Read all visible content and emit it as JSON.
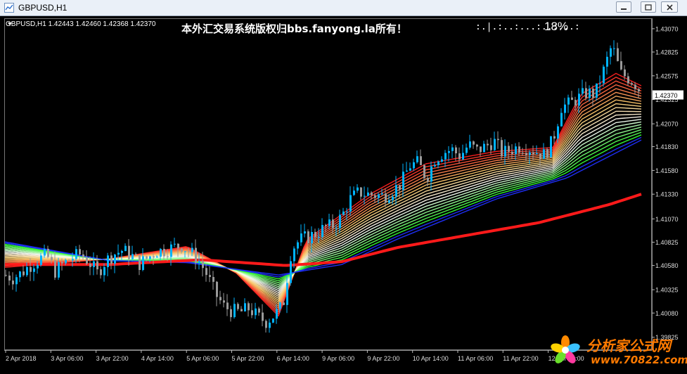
{
  "window": {
    "title": "GBPUSD,H1"
  },
  "chart_header": {
    "symbol_info": "GBPUSD,H1  1.42443 1.42460 1.42368 1.42370",
    "title": "本外汇交易系统版权归bbs.fanyong.la所有！",
    "progress_text": ":.|.:..:...:..:...:",
    "progress_percent": "18%"
  },
  "watermark": {
    "brand_cn": "分析家公式网",
    "url": "www.70822.com"
  },
  "colors": {
    "background": "#000000",
    "bull_candle": "#00b4ff",
    "bear_candle": "#9a9a9a",
    "slow_ma": "#ff1a1a",
    "ribbon_top": "#ff2020",
    "ribbon_mid": "#ffffff",
    "ribbon_low": "#22ff22",
    "ribbon_bottom": "#2030ff",
    "current_price_box": "#ffffff"
  },
  "chart_data": {
    "type": "candlestick",
    "symbol": "GBPUSD",
    "timeframe": "H1",
    "current_price": "1.42370",
    "ylim": [
      1.3969,
      1.4318
    ],
    "y_ticks": [
      "1.43070",
      "1.42825",
      "1.42575",
      "1.42325",
      "1.42070",
      "1.41830",
      "1.41580",
      "1.41330",
      "1.41070",
      "1.40825",
      "1.40580",
      "1.40325",
      "1.40080",
      "1.39825"
    ],
    "x_ticks": [
      "2 Apr 2018",
      "3 Apr 06:00",
      "3 Apr 22:00",
      "4 Apr 14:00",
      "5 Apr 06:00",
      "5 Apr 22:00",
      "6 Apr 14:00",
      "9 Apr 06:00",
      "9 Apr 22:00",
      "10 Apr 14:00",
      "11 Apr 06:00",
      "11 Apr 22:00",
      "12 Apr 14:00"
    ],
    "close_path": [
      [
        0,
        1.4048
      ],
      [
        12,
        1.4045
      ],
      [
        24,
        1.405
      ],
      [
        36,
        1.4058
      ],
      [
        48,
        1.4064
      ],
      [
        60,
        1.4069
      ],
      [
        72,
        1.4052
      ],
      [
        84,
        1.406
      ],
      [
        96,
        1.4066
      ],
      [
        108,
        1.407
      ],
      [
        120,
        1.4062
      ],
      [
        132,
        1.405
      ],
      [
        144,
        1.4063
      ],
      [
        156,
        1.407
      ],
      [
        168,
        1.4074
      ],
      [
        180,
        1.4069
      ],
      [
        192,
        1.406
      ],
      [
        204,
        1.4066
      ],
      [
        216,
        1.4073
      ],
      [
        228,
        1.4074
      ],
      [
        240,
        1.4077
      ],
      [
        252,
        1.4079
      ],
      [
        264,
        1.4072
      ],
      [
        276,
        1.4064
      ],
      [
        288,
        1.4048
      ],
      [
        300,
        1.4028
      ],
      [
        312,
        1.4015
      ],
      [
        324,
        1.401
      ],
      [
        336,
        1.4009
      ],
      [
        348,
        1.4013
      ],
      [
        360,
        1.4004
      ],
      [
        372,
        1.3999
      ],
      [
        384,
        1.4006
      ],
      [
        396,
        1.4016
      ],
      [
        408,
        1.4075
      ],
      [
        420,
        1.4085
      ],
      [
        432,
        1.4088
      ],
      [
        444,
        1.4092
      ],
      [
        456,
        1.4098
      ],
      [
        468,
        1.41
      ],
      [
        480,
        1.411
      ],
      [
        492,
        1.4128
      ],
      [
        504,
        1.4135
      ],
      [
        516,
        1.4133
      ],
      [
        528,
        1.4132
      ],
      [
        540,
        1.4131
      ],
      [
        552,
        1.4137
      ],
      [
        564,
        1.4144
      ],
      [
        576,
        1.4163
      ],
      [
        588,
        1.4166
      ],
      [
        600,
        1.415
      ],
      [
        612,
        1.417
      ],
      [
        624,
        1.4177
      ],
      [
        636,
        1.418
      ],
      [
        648,
        1.4173
      ],
      [
        660,
        1.4185
      ],
      [
        672,
        1.4179
      ],
      [
        684,
        1.4183
      ],
      [
        696,
        1.4189
      ],
      [
        708,
        1.4176
      ],
      [
        720,
        1.418
      ],
      [
        732,
        1.4183
      ],
      [
        744,
        1.4182
      ],
      [
        756,
        1.4178
      ],
      [
        768,
        1.4174
      ],
      [
        780,
        1.419
      ],
      [
        792,
        1.4225
      ],
      [
        804,
        1.4228
      ],
      [
        816,
        1.4234
      ],
      [
        828,
        1.424
      ],
      [
        840,
        1.4238
      ],
      [
        852,
        1.4263
      ],
      [
        864,
        1.429
      ],
      [
        876,
        1.426
      ],
      [
        888,
        1.4255
      ],
      [
        900,
        1.4247
      ],
      [
        906,
        1.4237
      ]
    ],
    "slow_ma": [
      [
        0,
        1.4059
      ],
      [
        150,
        1.4059
      ],
      [
        280,
        1.4064
      ],
      [
        400,
        1.4058
      ],
      [
        480,
        1.4062
      ],
      [
        560,
        1.4077
      ],
      [
        660,
        1.409
      ],
      [
        760,
        1.4103
      ],
      [
        860,
        1.4122
      ],
      [
        906,
        1.4133
      ]
    ],
    "series": [
      {
        "name": "Ribbon top (fast MA)",
        "values": [
          [
            0,
            1.4056
          ],
          [
            150,
            1.4065
          ],
          [
            260,
            1.4078
          ],
          [
            330,
            1.405
          ],
          [
            390,
            1.4005
          ],
          [
            430,
            1.4085
          ],
          [
            520,
            1.4133
          ],
          [
            600,
            1.4165
          ],
          [
            700,
            1.4178
          ],
          [
            780,
            1.4182
          ],
          [
            820,
            1.4238
          ],
          [
            870,
            1.426
          ],
          [
            906,
            1.4247
          ]
        ]
      },
      {
        "name": "Ribbon bottom (slow MA)",
        "values": [
          [
            0,
            1.4083
          ],
          [
            150,
            1.4063
          ],
          [
            260,
            1.4061
          ],
          [
            390,
            1.4048
          ],
          [
            480,
            1.4059
          ],
          [
            560,
            1.4086
          ],
          [
            700,
            1.4128
          ],
          [
            800,
            1.415
          ],
          [
            906,
            1.419
          ]
        ]
      }
    ]
  }
}
